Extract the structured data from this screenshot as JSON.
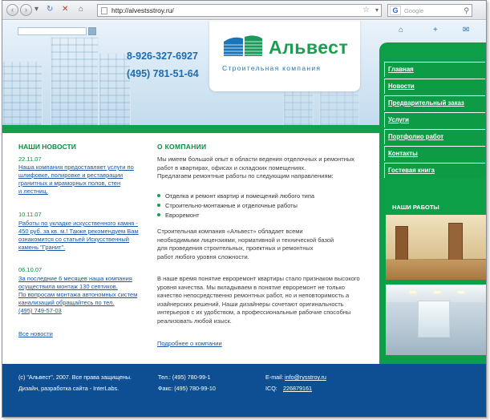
{
  "browser": {
    "url": "http://alvestsstroy.ru/",
    "search_placeholder": "Google",
    "search_engine_icon": "G"
  },
  "header": {
    "phone_mobile": "8-926-327-6927",
    "phone_city": "(495) 781-51-64",
    "logo_name": "Альвест",
    "logo_tagline": "Строительная компания",
    "icons": [
      "home-icon",
      "plus-icon",
      "mail-icon"
    ]
  },
  "menu": {
    "items": [
      "Главная",
      "Новости",
      "Предварительный заказ",
      "Услуги",
      "Портфолио работ",
      "Контакты",
      "Гостевая книга"
    ],
    "works_title": "НАШИ РАБОТЫ"
  },
  "news": {
    "title": "НАШИ НОВОСТИ",
    "items": [
      {
        "date": "22.11.07",
        "text_lines": [
          "Наша компания предоставляет услуги по",
          "шлифовке, полировке и реставрации",
          "гранитных и мраморных полов, стен",
          "и лестниц."
        ]
      },
      {
        "date": "10.11.07",
        "text_lines": [
          "Работы по укладке искусственного камня -",
          "450 руб. за кв. м.! Также рекомендуем Вам",
          "ознакомится со статьей Искусственный",
          "камень \"Гранит\"."
        ]
      },
      {
        "date": "06.10.07",
        "text_lines": [
          "За последние 6 месяцев наша компания",
          "осуществила монтаж 130 септиков.",
          "По вопросам монтажа автономных систем",
          "канализаций обращайтесь по тел.",
          "(495) 749-57-03"
        ]
      }
    ],
    "all_news": "Все новости"
  },
  "about": {
    "title": "О КОМПАНИИ",
    "intro_lines": [
      "Мы имеем большой опыт в области ведения отделочных и ремонтных",
      "работ в квартирах, офисах и складских помещениях.",
      "Предлагаем ремонтные работы по следующим направлениям:"
    ],
    "bullets": [
      "Отделка и ремонт квартир и помещений любого типа",
      "Строительно-монтажные и отделочные работы",
      "Евроремонт"
    ],
    "para2_lines": [
      "Строительная компания «Альвест» обладает всеми",
      "необходимыми лицензиями, нормативной и технической базой",
      "для проведения строительных, проектных и ремонтных",
      "работ любого уровня сложности."
    ],
    "para3_lines": [
      "В наше время понятие евроремонт квартиры стало признаком высокого",
      "уровня качества. Мы вкладываем в понятие евроремонт не только",
      "качество непосредственно ремонтных работ, но и неповторимость а",
      "изайнерских решений. Наши дизайнеры сочетают оригинальность",
      "интерьеров с их удобством, а профессиональные рабочие способны",
      "реализовать любой изыск."
    ],
    "more_link": "Подробнее о компании"
  },
  "footer": {
    "copyright": "(с) \"Альвест\", 2007. Все права защищены.",
    "design": "Дизайн, разработка сайта - InterLabs.",
    "phone_label": "Тел.: (495) 780-99-1",
    "fax_label": "Факс: (495) 780-99-10",
    "email_label": "E-mail:",
    "email_value": "info@rysstroy.ru",
    "icq_label": "ICQ:",
    "icq_value": "226879161"
  }
}
